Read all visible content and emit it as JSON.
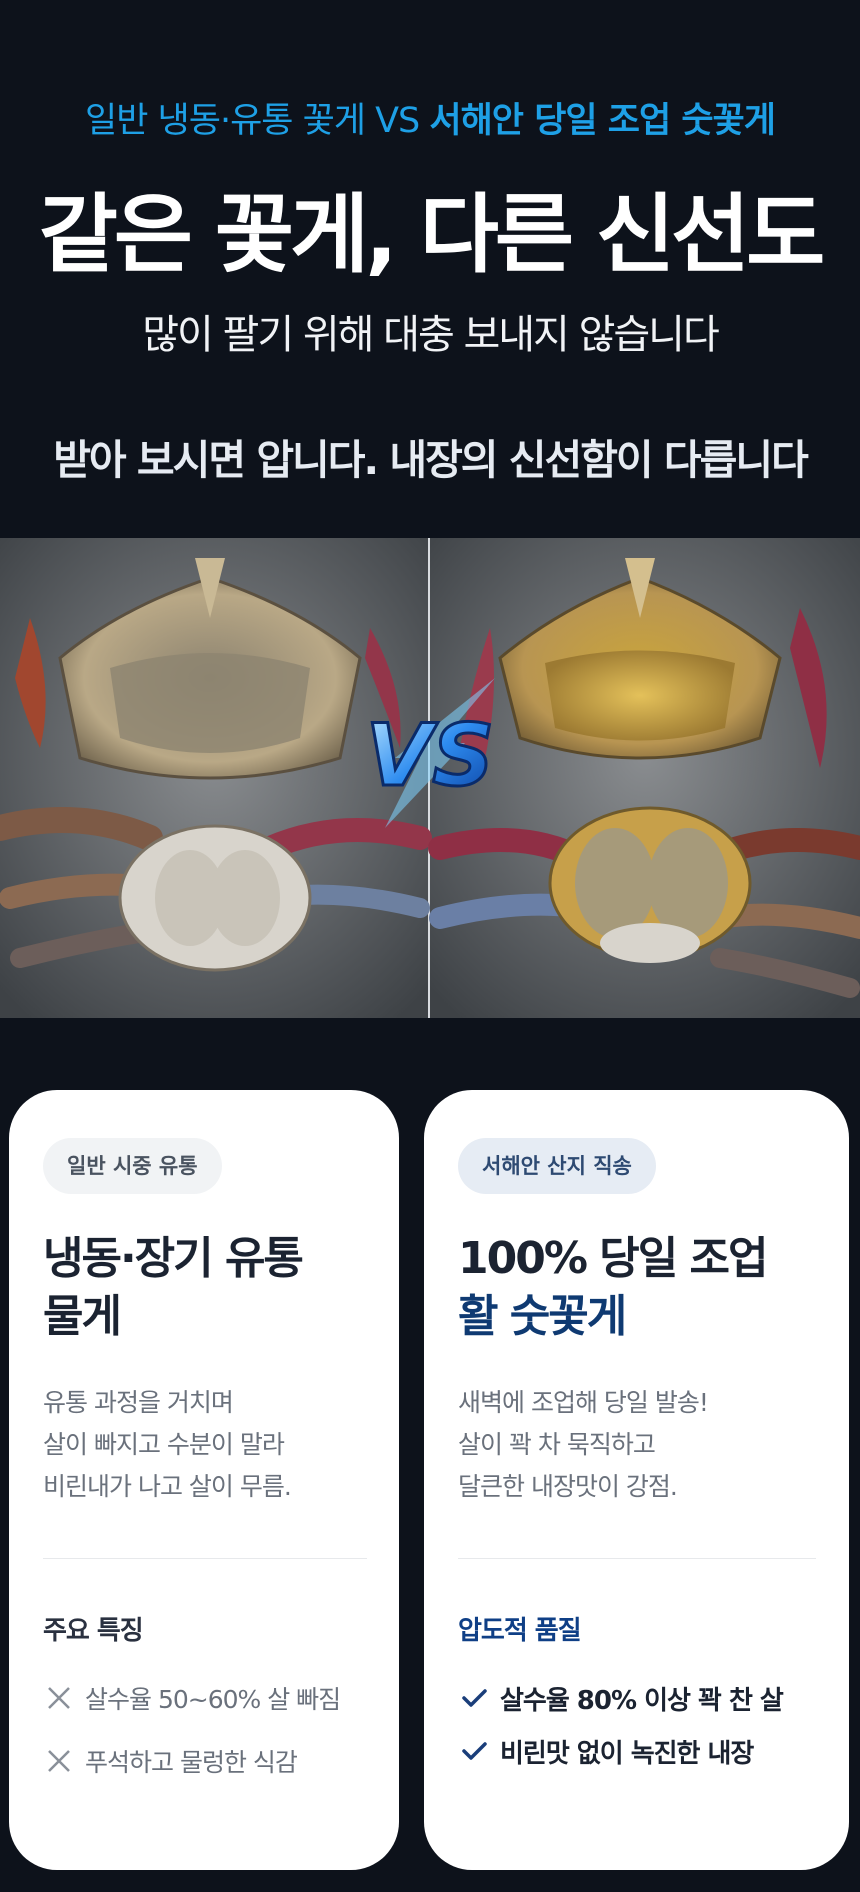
{
  "header": {
    "eyebrow_normal": "일반 냉동·유통 꽃게 VS ",
    "eyebrow_bold": "서해안 당일 조업 숫꽃게",
    "headline": "같은 꽃게, 다른 신선도",
    "subline": "많이 팔기 위해 대충 보내지 않습니다",
    "tagline": "받아 보시면 압니다. 내장의 신선함이 다릅니다"
  },
  "photo": {
    "left_subject": "frozen-crab-empty-shell",
    "right_subject": "fresh-crab-full-roe",
    "badge_icon": "vs-lightning-icon"
  },
  "cards": {
    "left": {
      "badge": "일반 시중 유통",
      "title_lines": [
        "냉동·장기 유통",
        "물게"
      ],
      "desc_lines": [
        "유통 과정을 거치며",
        "살이 빠지고 수분이 말라",
        "비린내가 나고 살이 무름."
      ],
      "feature_heading": "주요 특징",
      "features": [
        "살수율 50~60% 살 빠짐",
        "푸석하고 물렁한 식감"
      ],
      "feature_icon": "x-mark-icon"
    },
    "right": {
      "badge": "서해안 산지 직송",
      "title_lines": [
        "100% 당일 조업",
        "활 숫꽃게"
      ],
      "desc_lines": [
        "새벽에 조업해 당일 발송!",
        "살이 꽉 차 묵직하고",
        "달큰한 내장맛이 강점."
      ],
      "feature_heading": "압도적 품질",
      "features": [
        "살수율 80% 이상 꽉 찬 살",
        "비린맛 없이 녹진한 내장"
      ],
      "feature_icon": "checkmark-icon"
    }
  },
  "colors": {
    "background": "#0d121b",
    "eyebrow": "#1ea0e6",
    "accent_navy": "#0f3a72",
    "card_bg": "#ffffff"
  }
}
